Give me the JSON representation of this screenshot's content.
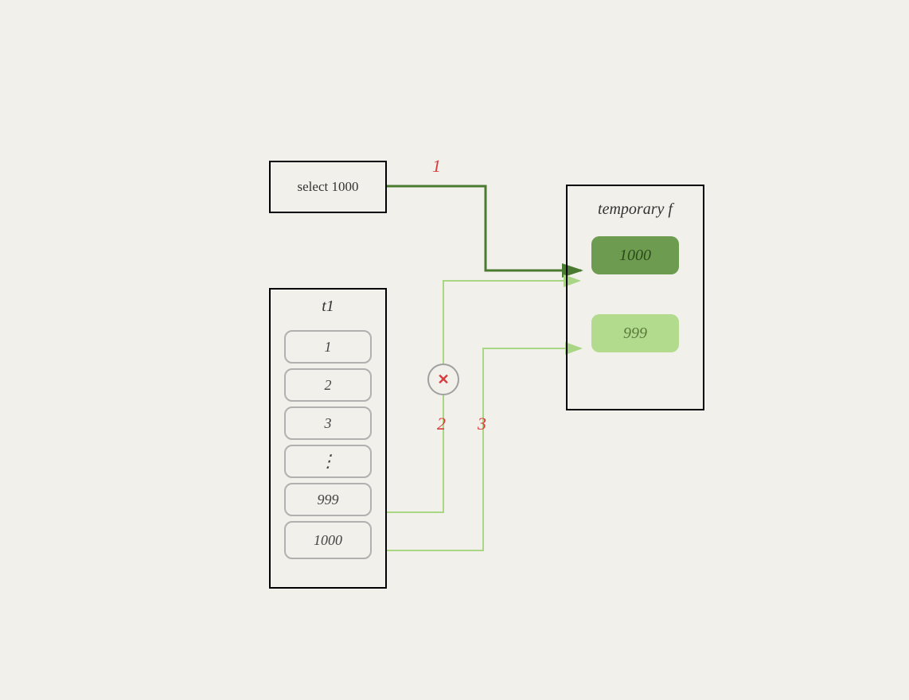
{
  "select": {
    "label": "select 1000"
  },
  "t1": {
    "label": "t1",
    "rows": [
      "1",
      "2",
      "3",
      "⋮",
      "999",
      "1000"
    ]
  },
  "temp": {
    "label": "temporary f",
    "pill1": "1000",
    "pill2": "999"
  },
  "annotations": {
    "a1": "1",
    "a2": "2",
    "a3": "3",
    "x": "✕"
  },
  "colors": {
    "dark_green": "#4a7a2f",
    "light_green": "#a8d685",
    "red": "#d83b3b"
  }
}
